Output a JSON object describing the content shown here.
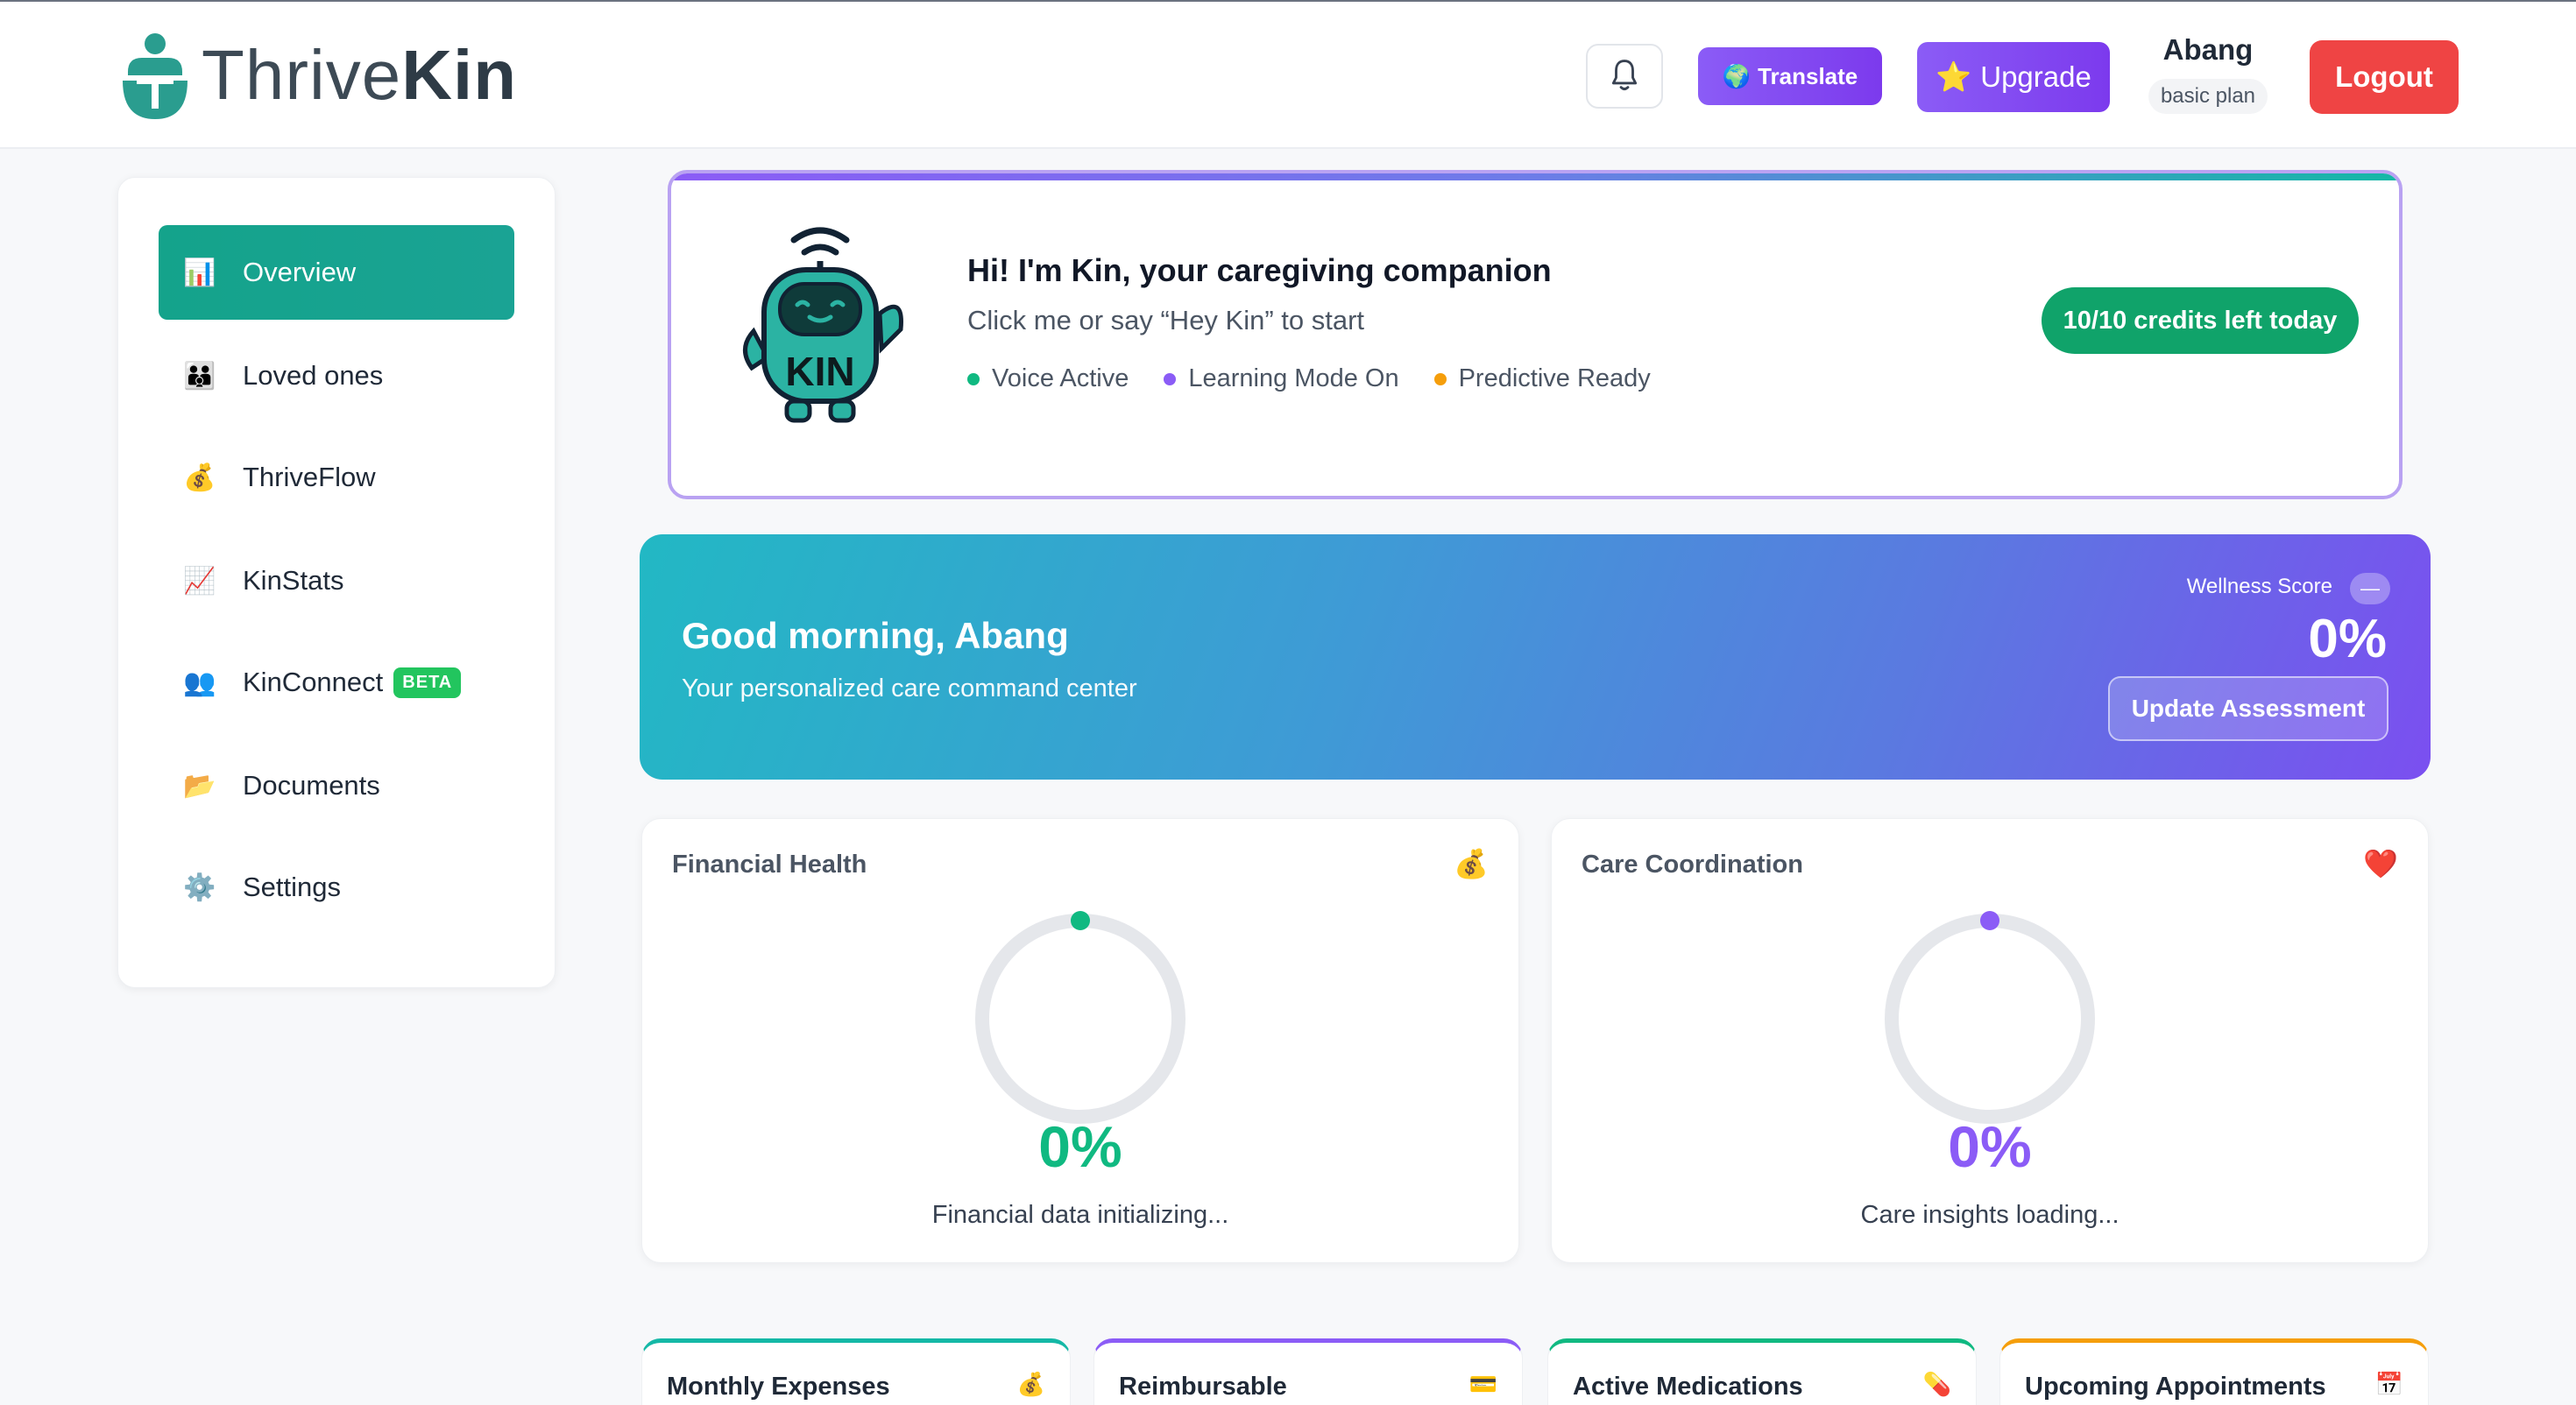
{
  "header": {
    "logo_light": "Thrive",
    "logo_bold": "Kin",
    "translate_label": "Translate",
    "translate_icon": "globe-icon",
    "upgrade_label": "Upgrade",
    "upgrade_icon": "star-icon",
    "user_name": "Abang",
    "user_plan": "basic plan",
    "logout_label": "Logout",
    "accent_purple": "#7c3aed",
    "logout_color": "#ef4444"
  },
  "sidebar": {
    "items": [
      {
        "label": "Overview",
        "icon": "📊",
        "active": true
      },
      {
        "label": "Loved ones",
        "icon": "👪"
      },
      {
        "label": "ThriveFlow",
        "icon": "💰"
      },
      {
        "label": "KinStats",
        "icon": "📈"
      },
      {
        "label": "KinConnect",
        "icon": "👥",
        "badge": "BETA"
      },
      {
        "label": "Documents",
        "icon": "📂"
      },
      {
        "label": "Settings",
        "icon": "⚙️"
      }
    ],
    "active_color": "#14a38b"
  },
  "kin": {
    "bot_label": "KIN",
    "title": "Hi! I'm Kin, your caregiving companion",
    "subtitle": "Click me or say “Hey Kin” to start",
    "status": [
      {
        "label": "Voice Active",
        "color": "#10b981"
      },
      {
        "label": "Learning Mode On",
        "color": "#8b5cf6"
      },
      {
        "label": "Predictive Ready",
        "color": "#f59e0b"
      }
    ],
    "credits": "10/10 credits left today"
  },
  "greeting": {
    "title": "Good morning, Abang",
    "subtitle": "Your personalized care command center",
    "wellness_label": "Wellness Score",
    "wellness_toggle": "—",
    "wellness_value": "0%",
    "update_label": "Update Assessment"
  },
  "metrics": [
    {
      "title": "Financial Health",
      "icon": "💰",
      "value": "0%",
      "note": "Financial data initializing...",
      "color": "#10b981"
    },
    {
      "title": "Care Coordination",
      "icon": "❤️",
      "value": "0%",
      "note": "Care insights loading...",
      "color": "#8b5cf6"
    }
  ],
  "bottom_cards": [
    {
      "title": "Monthly Expenses",
      "icon": "💰",
      "color": "#14b8a6"
    },
    {
      "title": "Reimbursable",
      "icon": "💳",
      "color": "#8b5cf6"
    },
    {
      "title": "Active Medications",
      "icon": "💊",
      "color": "#10b981"
    },
    {
      "title": "Upcoming Appointments",
      "icon": "📅",
      "color": "#f59e0b"
    }
  ]
}
